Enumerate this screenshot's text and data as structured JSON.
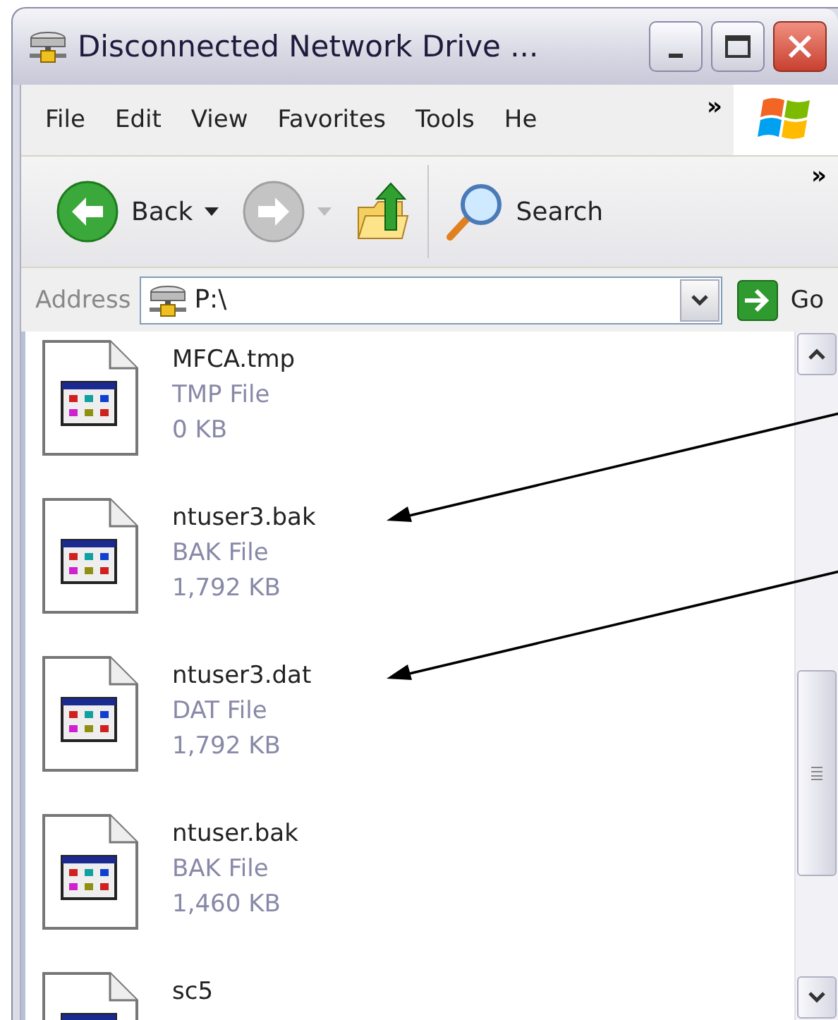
{
  "window": {
    "title": "Disconnected Network Drive ..."
  },
  "menu": [
    {
      "label": "File"
    },
    {
      "label": "Edit"
    },
    {
      "label": "View"
    },
    {
      "label": "Favorites"
    },
    {
      "label": "Tools"
    },
    {
      "label": "He"
    }
  ],
  "menu_overflow": "»",
  "toolbar": {
    "back": {
      "label": "Back",
      "disabled": false
    },
    "forward": {
      "disabled": true
    },
    "search": {
      "label": "Search"
    },
    "overflow": "»"
  },
  "address": {
    "label": "Address",
    "value": "P:\\",
    "go": "Go"
  },
  "files": [
    {
      "name": "MFCA.tmp",
      "type": "TMP File",
      "size": "0 KB",
      "arrow": false
    },
    {
      "name": "ntuser3.bak",
      "type": "BAK File",
      "size": "1,792 KB",
      "arrow": true
    },
    {
      "name": "ntuser3.dat",
      "type": "DAT File",
      "size": "1,792 KB",
      "arrow": true
    },
    {
      "name": "ntuser.bak",
      "type": "BAK File",
      "size": "1,460 KB",
      "arrow": false
    },
    {
      "name": "sc5",
      "arrow": false
    }
  ]
}
